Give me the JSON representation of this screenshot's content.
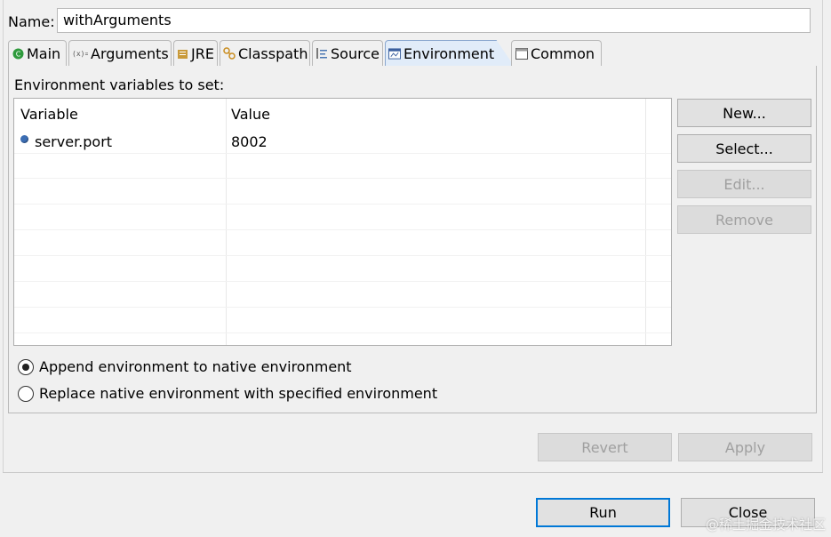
{
  "name_label": "Name:",
  "name_value": "withArguments",
  "tabs": [
    {
      "label": "Main",
      "icon": "main-icon"
    },
    {
      "label": "Arguments",
      "icon": "arguments-icon"
    },
    {
      "label": "JRE",
      "icon": "jre-icon"
    },
    {
      "label": "Classpath",
      "icon": "classpath-icon"
    },
    {
      "label": "Source",
      "icon": "source-icon"
    },
    {
      "label": "Environment",
      "icon": "environment-icon"
    },
    {
      "label": "Common",
      "icon": "common-icon"
    }
  ],
  "env_label": "Environment variables to set:",
  "table": {
    "headers": [
      "Variable",
      "Value"
    ],
    "rows": [
      {
        "variable": "server.port",
        "value": "8002"
      }
    ]
  },
  "side_buttons": {
    "new": "New...",
    "select": "Select...",
    "edit": "Edit...",
    "remove": "Remove"
  },
  "radios": {
    "append": "Append environment to native environment",
    "replace": "Replace native environment with specified environment",
    "selected": "append"
  },
  "footer_buttons": {
    "revert": "Revert",
    "apply": "Apply",
    "run": "Run",
    "close": "Close"
  },
  "watermark": "@稀土掘金技术社区",
  "colors": {
    "active_tab": "#e1ecf9",
    "run_border": "#0078d7",
    "row_bullet": "#3c6eb4"
  }
}
